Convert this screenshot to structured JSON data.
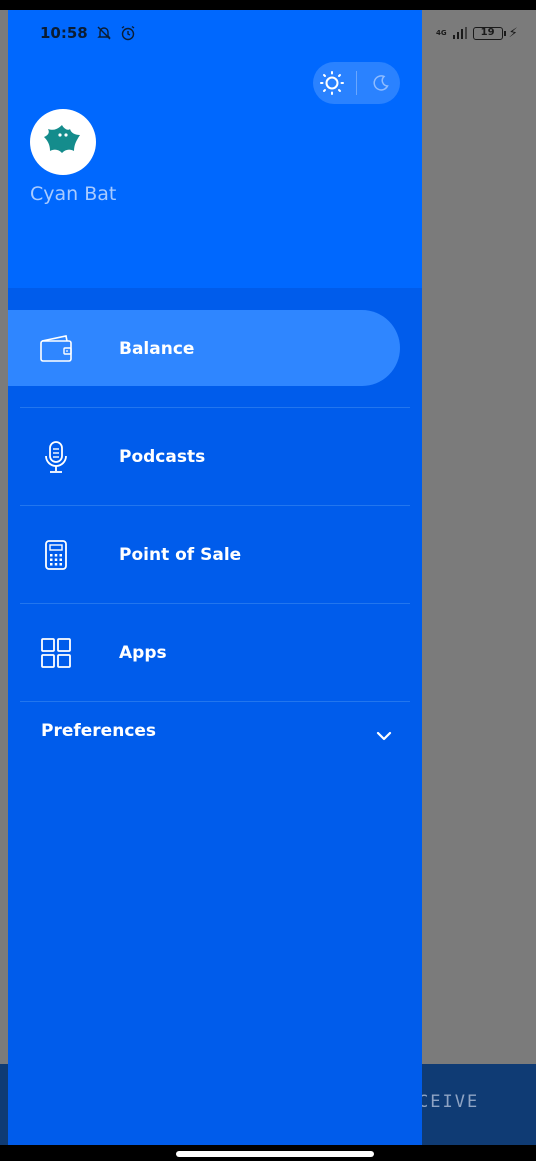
{
  "status_bar": {
    "time": "10:58",
    "network": "4G",
    "battery": "19"
  },
  "drawer": {
    "username": "Cyan Bat",
    "theme_toggle": {
      "light_icon": "sun-icon",
      "dark_icon": "moon-icon"
    },
    "menu": [
      {
        "label": "Balance",
        "icon": "wallet-icon",
        "active": true
      },
      {
        "label": "Podcasts",
        "icon": "microphone-icon",
        "active": false
      },
      {
        "label": "Point of Sale",
        "icon": "calculator-icon",
        "active": false
      },
      {
        "label": "Apps",
        "icon": "apps-grid-icon",
        "active": false
      }
    ],
    "preferences_label": "Preferences"
  },
  "background": {
    "bottom_button_label": "CEIVE"
  },
  "colors": {
    "drawer": "#005ceb",
    "header": "#0068fe",
    "active_item": "#2f86ff",
    "backdrop": "#7b7b7b",
    "bottom_bar": "#0f3b74"
  }
}
